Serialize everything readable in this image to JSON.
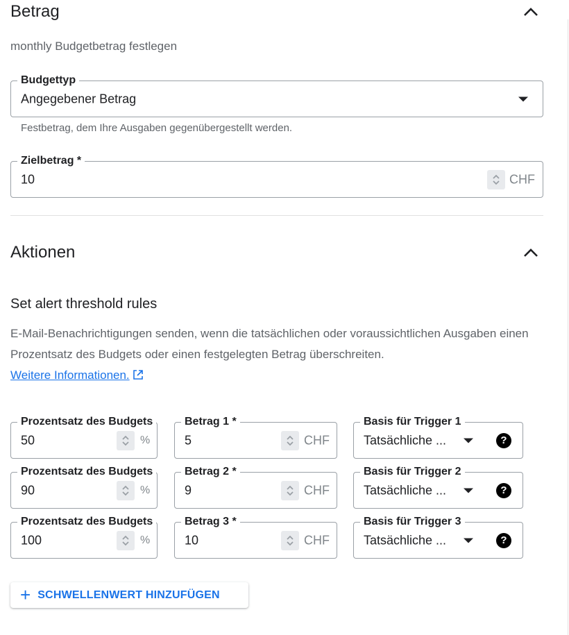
{
  "amount_section": {
    "title": "Betrag",
    "subtitle": "monthly Budgetbetrag festlegen",
    "budget_type": {
      "label": "Budgettyp",
      "value": "Angegebener Betrag",
      "hint": "Festbetrag, dem Ihre Ausgaben gegenübergestellt werden."
    },
    "target_amount": {
      "label": "Zielbetrag *",
      "value": "10",
      "unit": "CHF"
    }
  },
  "actions_section": {
    "title": "Aktionen",
    "rules_title": "Set alert threshold rules",
    "description": "E-Mail-Benachrichtigungen senden, wenn die tatsächlichen oder voraussichtlichen Ausgaben einen Prozentsatz des Budgets oder einen festgelegten Betrag überschreiten.",
    "link_text": "Weitere Informationen.",
    "thresholds": [
      {
        "percent_label": "Prozentsatz des Budgets",
        "percent_value": "50",
        "percent_unit": "%",
        "amount_label": "Betrag 1 *",
        "amount_value": "5",
        "amount_unit": "CHF",
        "basis_label": "Basis für Trigger 1",
        "basis_value": "Tatsächliche ..."
      },
      {
        "percent_label": "Prozentsatz des Budgets",
        "percent_value": "90",
        "percent_unit": "%",
        "amount_label": "Betrag 2 *",
        "amount_value": "9",
        "amount_unit": "CHF",
        "basis_label": "Basis für Trigger 2",
        "basis_value": "Tatsächliche ..."
      },
      {
        "percent_label": "Prozentsatz des Budgets",
        "percent_value": "100",
        "percent_unit": "%",
        "amount_label": "Betrag 3 *",
        "amount_value": "10",
        "amount_unit": "CHF",
        "basis_label": "Basis für Trigger 3",
        "basis_value": "Tatsächliche ..."
      }
    ],
    "add_button_label": "SCHWELLENWERT HINZUFÜGEN"
  },
  "icons": {
    "collapse": "chevron-up-icon",
    "dropdown": "arrow-drop-down-icon",
    "stepper": "unfold-icon",
    "help": "help-icon",
    "external": "open-in-new-icon",
    "add": "plus-icon"
  },
  "colors": {
    "link": "#1a73e8",
    "border": "#9aa0a6",
    "secondary_text": "#5f6368"
  }
}
